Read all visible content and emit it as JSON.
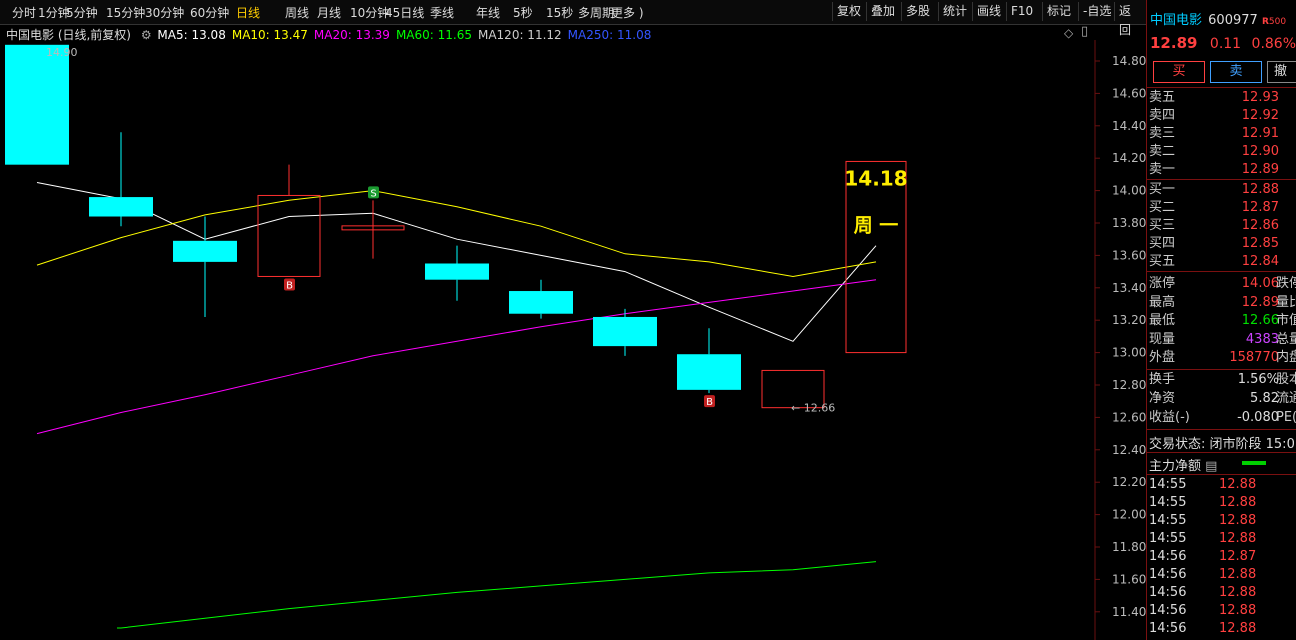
{
  "toolbar": {
    "periods": [
      "分时",
      "1分钟",
      "5分钟",
      "15分钟",
      "30分钟",
      "60分钟",
      "日线",
      "周线",
      "月线",
      "10分钟",
      "45日线",
      "季线",
      "年线",
      "5秒",
      "15秒",
      "多周期",
      "更多 )"
    ],
    "active_period": "日线",
    "right_buttons": [
      "复权",
      "叠加",
      "多股",
      "统计",
      "画线",
      "F10",
      "标记",
      "-自选",
      "返回"
    ]
  },
  "ma_legend": {
    "title": "中国电影 (日线,前复权)",
    "items": [
      {
        "label": "MA5: 13.08",
        "color": "#ffffff"
      },
      {
        "label": "MA10: 13.47",
        "color": "#ffff00"
      },
      {
        "label": "MA20: 13.39",
        "color": "#ff00ff"
      },
      {
        "label": "MA60: 11.65",
        "color": "#00ff00"
      },
      {
        "label": "MA120: 11.12",
        "color": "#cccccc"
      },
      {
        "label": "MA250: 11.08",
        "color": "#3355ff"
      }
    ]
  },
  "chart_data": {
    "type": "candlestick",
    "ylim": [
      11.3,
      14.95
    ],
    "yticks": [
      "14.80",
      "14.60",
      "14.40",
      "14.20",
      "14.00",
      "13.80",
      "13.60",
      "13.40",
      "13.20",
      "13.00",
      "12.80",
      "12.60",
      "12.40",
      "12.20",
      "12.00",
      "11.80",
      "11.60",
      "11.40"
    ],
    "candles": [
      {
        "open": 14.9,
        "close": 14.16,
        "high": 14.9,
        "low": 14.16,
        "dir": "down"
      },
      {
        "open": 13.96,
        "close": 13.84,
        "high": 14.36,
        "low": 13.78,
        "dir": "down"
      },
      {
        "open": 13.69,
        "close": 13.56,
        "high": 13.84,
        "low": 13.22,
        "dir": "down"
      },
      {
        "open": 13.47,
        "close": 13.97,
        "high": 14.16,
        "low": 13.47,
        "dir": "up"
      },
      {
        "open": 13.77,
        "close": 13.77,
        "high": 13.94,
        "low": 13.58,
        "dir": "flat"
      },
      {
        "open": 13.55,
        "close": 13.45,
        "high": 13.66,
        "low": 13.32,
        "dir": "down"
      },
      {
        "open": 13.38,
        "close": 13.24,
        "high": 13.45,
        "low": 13.21,
        "dir": "down"
      },
      {
        "open": 13.22,
        "close": 13.04,
        "high": 13.27,
        "low": 12.98,
        "dir": "down"
      },
      {
        "open": 12.99,
        "close": 12.77,
        "high": 13.15,
        "low": 12.75,
        "dir": "down"
      },
      {
        "open": 12.66,
        "close": 12.89,
        "high": 12.89,
        "low": 12.66,
        "dir": "up"
      },
      {
        "open": 13.0,
        "close": 14.18,
        "high": 14.18,
        "low": 13.0,
        "dir": "up"
      }
    ],
    "ma_series": [
      {
        "name": "MA5",
        "color": "#ffffff",
        "values": [
          14.05,
          13.95,
          13.7,
          13.84,
          13.86,
          13.7,
          13.6,
          13.5,
          13.28,
          13.07,
          13.66
        ]
      },
      {
        "name": "MA10",
        "color": "#ffff00",
        "values": [
          13.54,
          13.71,
          13.85,
          13.94,
          14.0,
          13.9,
          13.78,
          13.61,
          13.56,
          13.47,
          13.56
        ]
      },
      {
        "name": "MA20",
        "color": "#ff00ff",
        "values": [
          12.5,
          12.63,
          12.74,
          12.86,
          12.98,
          13.07,
          13.16,
          13.24,
          13.31,
          13.38,
          13.45
        ]
      },
      {
        "name": "MA60",
        "color": "#00ff00",
        "values": [
          null,
          11.3,
          11.36,
          11.42,
          11.47,
          11.52,
          11.56,
          11.6,
          11.64,
          11.66,
          11.71
        ]
      }
    ],
    "annotations": {
      "high_label": "14.90",
      "low_label": "← 12.66",
      "signals": [
        {
          "candle": 3,
          "text": "B"
        },
        {
          "candle": 4,
          "text": "S"
        },
        {
          "candle": 8,
          "text": "B"
        }
      ],
      "forecast_price": "14.18",
      "forecast_day": "周 一"
    }
  },
  "panel": {
    "stock_name": "中国电影",
    "stock_code": "600977",
    "r_label": "R",
    "r_value": "500",
    "price": "12.89",
    "change": "0.11",
    "pct": "0.86%",
    "buy_btn": "买",
    "sell_btn": "卖",
    "cancel_btn": "撤",
    "asks": [
      {
        "label": "卖五",
        "price": "12.93"
      },
      {
        "label": "卖四",
        "price": "12.92"
      },
      {
        "label": "卖三",
        "price": "12.91"
      },
      {
        "label": "卖二",
        "price": "12.90"
      },
      {
        "label": "卖一",
        "price": "12.89"
      }
    ],
    "bids": [
      {
        "label": "买一",
        "price": "12.88"
      },
      {
        "label": "买二",
        "price": "12.87"
      },
      {
        "label": "买三",
        "price": "12.86"
      },
      {
        "label": "买四",
        "price": "12.85"
      },
      {
        "label": "买五",
        "price": "12.84"
      }
    ],
    "stats1": [
      {
        "label": "涨停",
        "value": "14.06",
        "color": "#ff4040",
        "ext": "跌停"
      },
      {
        "label": "最高",
        "value": "12.89",
        "color": "#ff4040",
        "ext": "量比"
      },
      {
        "label": "最低",
        "value": "12.66",
        "color": "#00e000",
        "ext": "市值"
      },
      {
        "label": "现量",
        "value": "4383",
        "color": "#cc44ff",
        "ext": "总量"
      },
      {
        "label": "外盘",
        "value": "158770",
        "color": "#ff4040",
        "ext": "内盘"
      }
    ],
    "stats2": [
      {
        "label": "换手",
        "value": "1.56%",
        "color": "#dddddd",
        "ext": "股本"
      },
      {
        "label": "净资",
        "value": "5.82",
        "color": "#dddddd",
        "ext": "流通"
      },
      {
        "label": "收益(-)",
        "value": "-0.080",
        "color": "#dddddd",
        "ext": "PE(动"
      }
    ],
    "trade_status": "交易状态: 闭市阶段 15:0",
    "main_flow": "主力净额",
    "ticks": [
      {
        "time": "14:55",
        "price": "12.88"
      },
      {
        "time": "14:55",
        "price": "12.88"
      },
      {
        "time": "14:55",
        "price": "12.88"
      },
      {
        "time": "14:55",
        "price": "12.88"
      },
      {
        "time": "14:56",
        "price": "12.87"
      },
      {
        "time": "14:56",
        "price": "12.88"
      },
      {
        "time": "14:56",
        "price": "12.88"
      },
      {
        "time": "14:56",
        "price": "12.88"
      },
      {
        "time": "14:56",
        "price": "12.88"
      }
    ]
  }
}
